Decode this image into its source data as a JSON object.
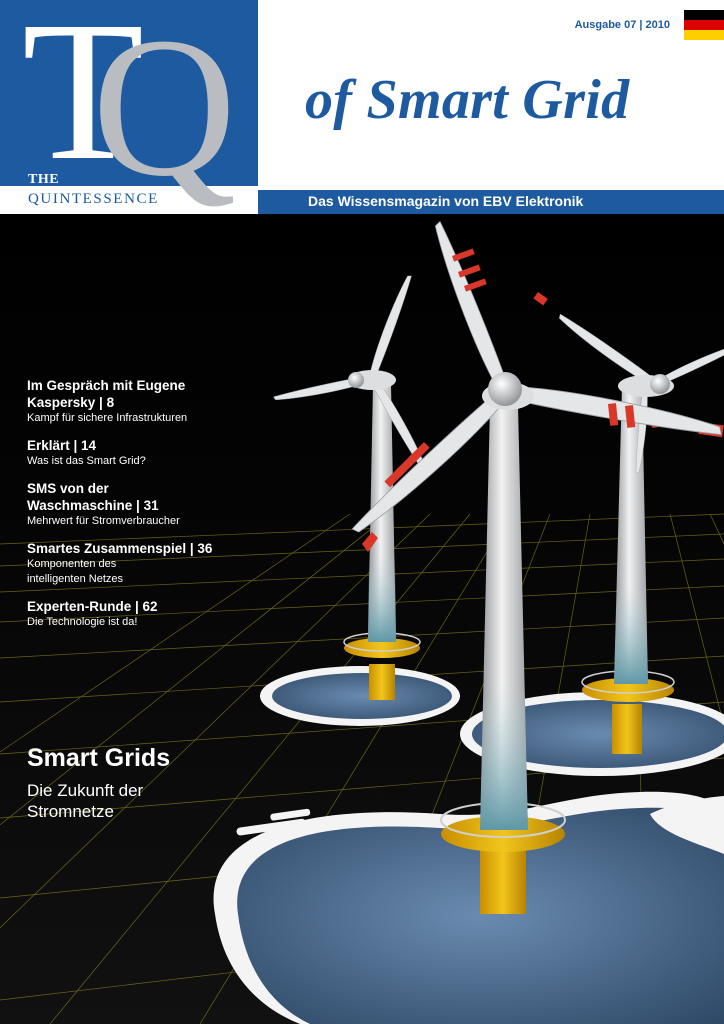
{
  "logo": {
    "letters": "TQ",
    "line1": "THE",
    "line2": "QUINTESSENCE"
  },
  "header": {
    "issue": "Ausgabe 07 | 2010",
    "title": "of Smart Grid",
    "subtitle": "Das Wissensmagazin von EBV Elektronik",
    "flag_colors": [
      "#000000",
      "#dd0000",
      "#ffce00"
    ],
    "brand_color": "#1d5aa0"
  },
  "toc": [
    {
      "head": "Im Gespräch mit Eugene Kaspersky | 8",
      "desc": "Kampf für sichere Infrastrukturen"
    },
    {
      "head": "Erklärt | 14",
      "desc": "Was ist das Smart Grid?"
    },
    {
      "head": "SMS von der Waschmaschine | 31",
      "desc": "Mehrwert für Stromverbraucher"
    },
    {
      "head": "Smartes Zusammenspiel | 36",
      "desc": "Komponenten des intelligenten Netzes"
    },
    {
      "head": "Experten-Runde | 62",
      "desc": "Die Technologie ist da!"
    }
  ],
  "lead": {
    "title": "Smart Grids",
    "subtitle": "Die Zukunft der Stromnetze"
  }
}
